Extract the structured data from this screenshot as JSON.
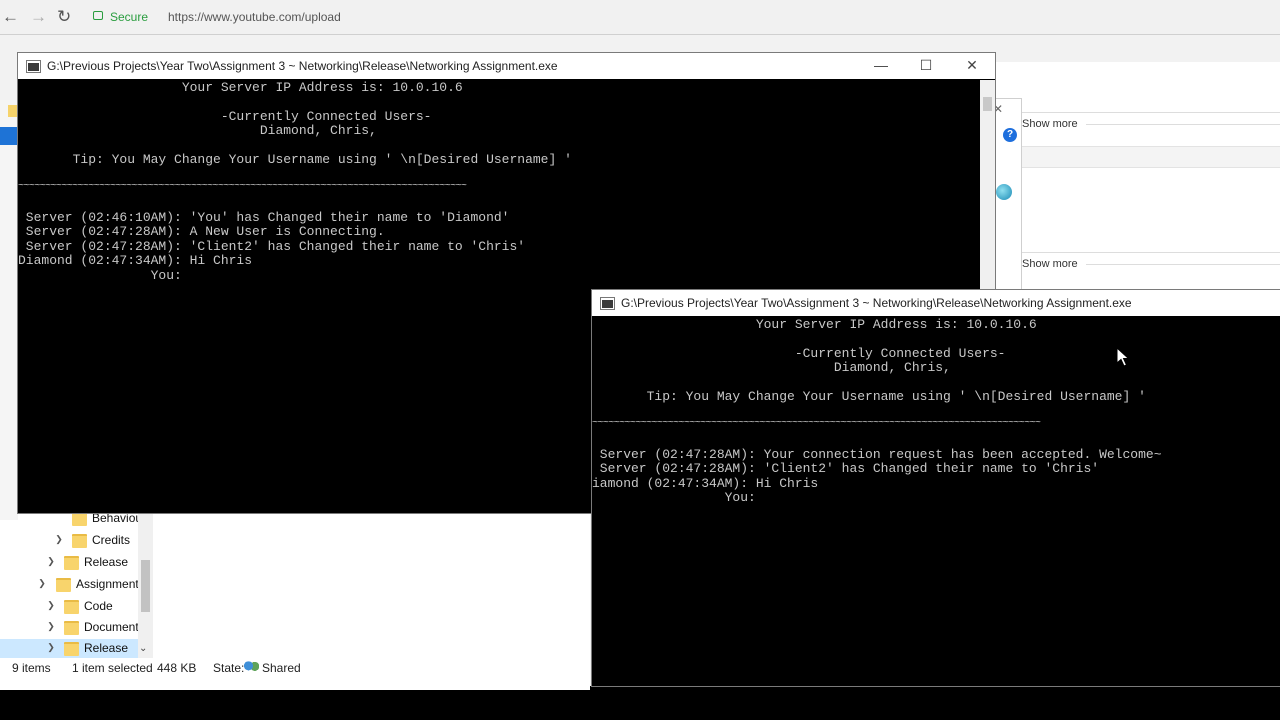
{
  "browser": {
    "secure_label": "Secure",
    "url": "https://www.youtube.com/upload",
    "show_more_1": "Show more",
    "show_more_2": "Show more",
    "help_glyph": "?",
    "close_glyph": "✕",
    "icons": [
      "back-arrow-icon",
      "forward-arrow-icon",
      "reload-icon",
      "lock-icon",
      "help-icon",
      "globe-icon"
    ]
  },
  "explorer": {
    "tree": [
      {
        "label": "Behaviou",
        "expanded": false
      },
      {
        "label": "Credits",
        "expanded": false
      },
      {
        "label": "Release",
        "expanded": false
      },
      {
        "label": "Assignment",
        "expanded": true
      },
      {
        "label": "Code",
        "expanded": false
      },
      {
        "label": "Document",
        "expanded": false
      },
      {
        "label": "Release",
        "expanded": false,
        "selected": true
      }
    ],
    "status": {
      "items": "9 items",
      "selected": "1 item selected",
      "size": "448 KB",
      "state_label": "State:",
      "state_value": "Shared"
    }
  },
  "console1": {
    "title": "G:\\Previous Projects\\Year Two\\Assignment 3 ~ Networking\\Release\\Networking Assignment.exe",
    "lines": [
      "                     Your Server IP Address is: 10.0.10.6",
      "",
      "                          -Currently Connected Users-",
      "                               Diamond, Chris,",
      "",
      "       Tip: You May Change Your Username using ' \\n[Desired Username] '",
      "",
      "~~~~~~~~~~~~~~~~~~~~~~~~~~~~~~~~~~~~~~~~~~~~~~~~~~~~~~~~~~~~~~~~~~~~~~~~~~~~~~~~~~~",
      "",
      " Server (02:46:10AM): 'You' has Changed their name to 'Diamond'",
      " Server (02:47:28AM): A New User is Connecting.",
      " Server (02:47:28AM): 'Client2' has Changed their name to 'Chris'",
      "Diamond (02:47:34AM): Hi Chris",
      "                 You:"
    ]
  },
  "console2": {
    "title": "G:\\Previous Projects\\Year Two\\Assignment 3 ~ Networking\\Release\\Networking Assignment.exe",
    "lines": [
      "                     Your Server IP Address is: 10.0.10.6",
      "",
      "                          -Currently Connected Users-",
      "                               Diamond, Chris,",
      "",
      "       Tip: You May Change Your Username using ' \\n[Desired Username] '",
      "",
      "~~~~~~~~~~~~~~~~~~~~~~~~~~~~~~~~~~~~~~~~~~~~~~~~~~~~~~~~~~~~~~~~~~~~~~~~~~~~~~~~~~~",
      "",
      " Server (02:47:28AM): Your connection request has been accepted. Welcome~",
      " Server (02:47:28AM): 'Client2' has Changed their name to 'Chris'",
      "iamond (02:47:34AM): Hi Chris",
      "                 You:"
    ]
  },
  "window_controls": {
    "minimize": "—",
    "maximize": "☐",
    "close": "✕"
  },
  "colors": {
    "console_bg": "#000000",
    "console_text": "#c8c8c8",
    "selection": "#cce8ff",
    "secure_green": "#2a9d3f"
  }
}
